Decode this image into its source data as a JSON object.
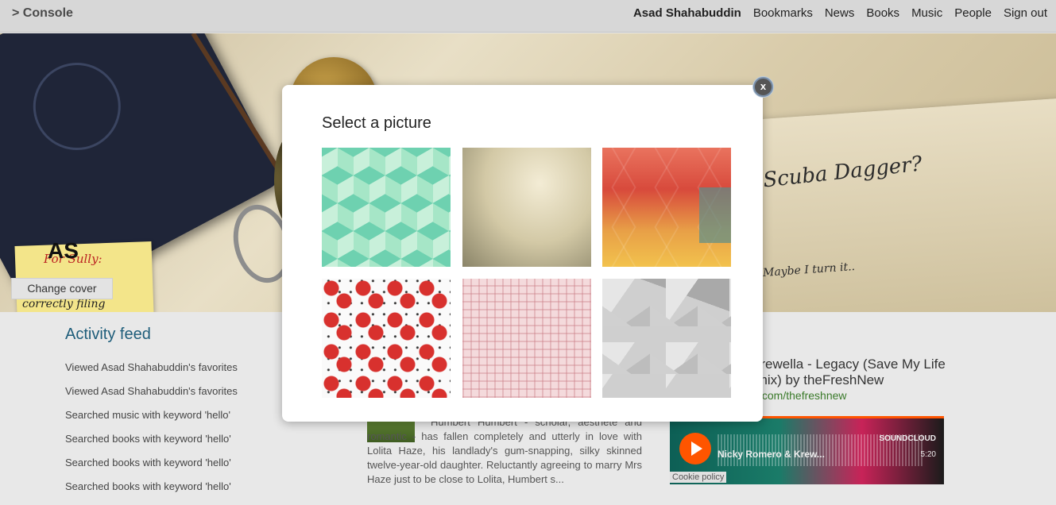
{
  "topbar": {
    "brand": "> Console",
    "nav": {
      "user": "Asad Shahabuddin",
      "items": [
        "Bookmarks",
        "News",
        "Books",
        "Music",
        "People",
        "Sign out"
      ]
    }
  },
  "cover": {
    "initials": "AS",
    "sticky_line1": "For Sully:",
    "sticky_line2": "correctly filing",
    "scribble": "Scuba Dagger?",
    "scribble2": "Maybe I turn it..",
    "change_cover_label": "Change cover"
  },
  "activity": {
    "title": "Activity feed",
    "items": [
      "Viewed Asad Shahabuddin's favorites",
      "Viewed Asad Shahabuddin's favorites",
      "Searched music with keyword 'hello'",
      "Searched books with keyword 'hello'",
      "Searched books with keyword 'hello'",
      "Searched books with keyword 'hello'"
    ]
  },
  "book": {
    "description": "Humbert Humbert - scholar, aesthete and romantic - has fallen completely and utterly in love with Lolita Haze, his landlady's gum-snapping, silky skinned twelve-year-old daughter. Reluctantly agreeing to marry Mrs Haze just to be close to Lolita, Humbert s..."
  },
  "music": {
    "track_title": "& Krewella - Legacy (Save My Life Remix) by theFreshNew",
    "link": ".com/thefreshnew",
    "player_name": "Nicky Romero & Krew...",
    "player_brand": "SOUNDCLOUD",
    "duration": "5:20",
    "cookie": "Cookie policy"
  },
  "modal": {
    "title": "Select a picture",
    "close_label": "x",
    "pictures": [
      "green-cube-pattern",
      "beige-texture",
      "geometric-warm-triangles",
      "red-roses-floral",
      "pink-plaid",
      "gray-polygons"
    ]
  }
}
